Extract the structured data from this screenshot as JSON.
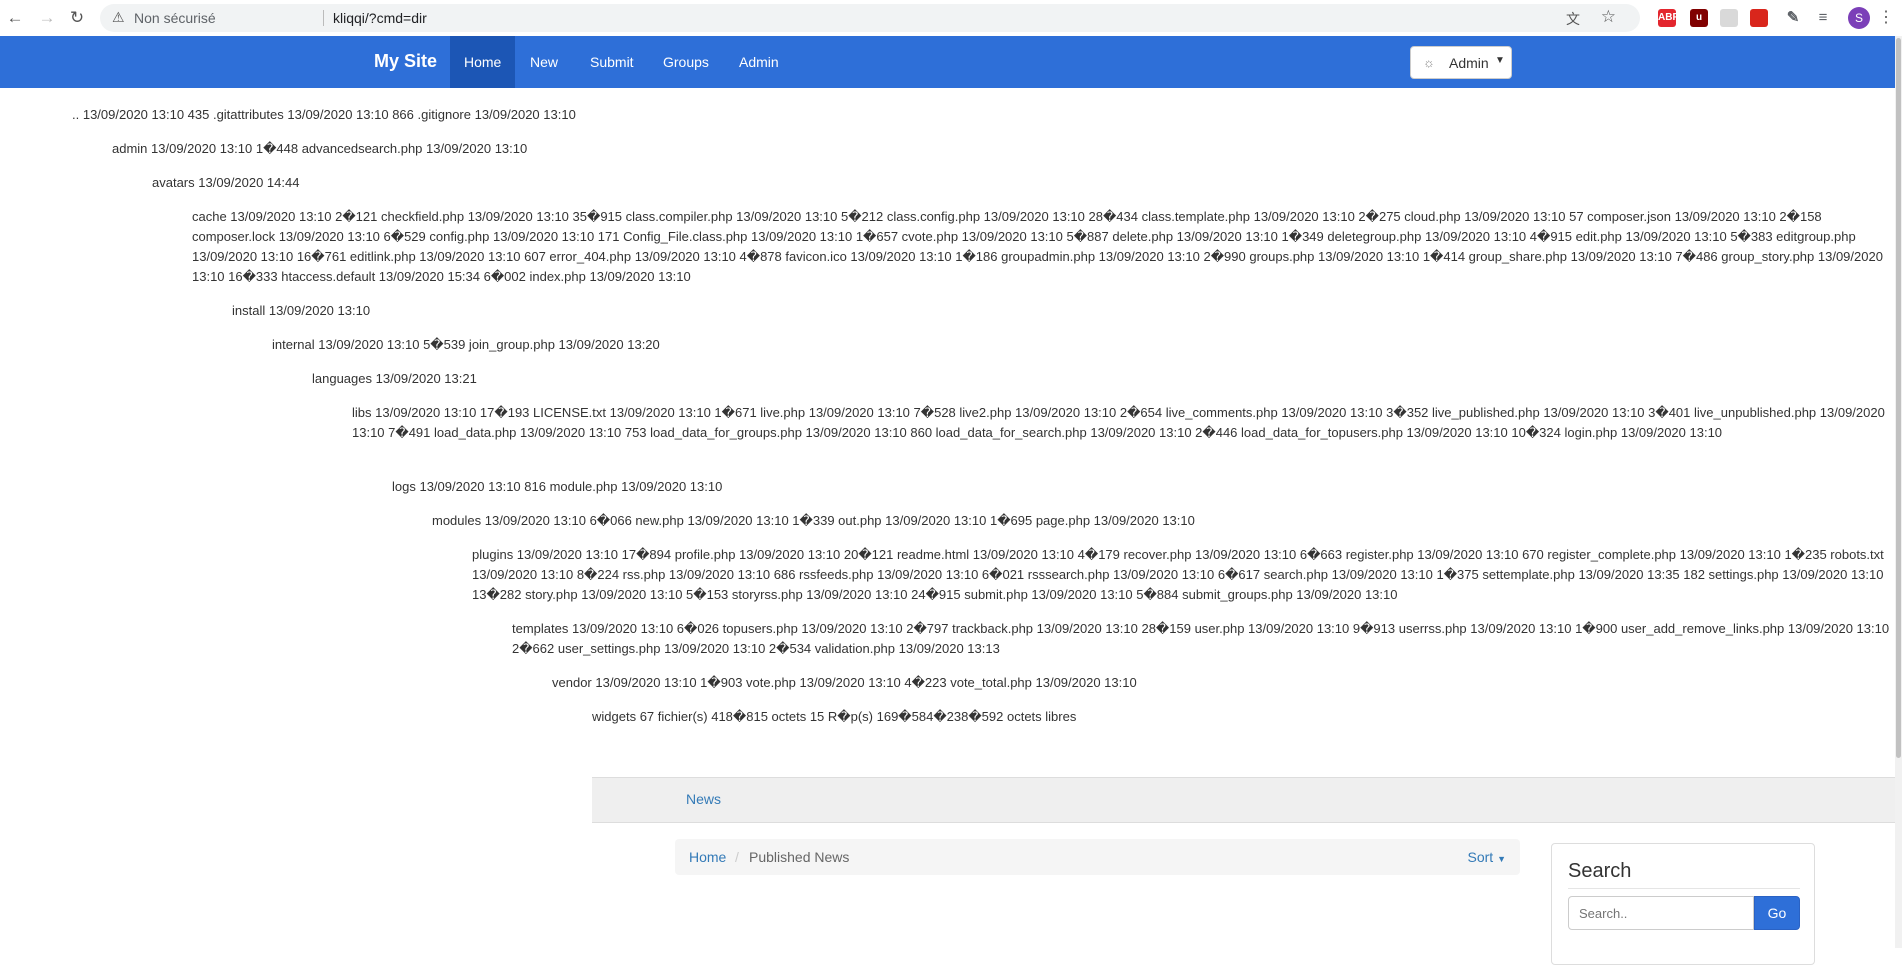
{
  "browser": {
    "security_label": "Non sécurisé",
    "url": "kliqqi/?cmd=dir",
    "profile_initial": "S",
    "extensions": [
      {
        "name": "abp-icon",
        "label": "ABP",
        "color": "#e3262e"
      },
      {
        "name": "ublock-icon",
        "label": "u",
        "color": "#800000"
      },
      {
        "name": "extension-box-icon",
        "label": "",
        "color": "#d9d9d9"
      },
      {
        "name": "screen-icon",
        "label": "",
        "color": "#d9261c"
      },
      {
        "name": "puzzle-icon",
        "label": "",
        "color": "#5f6368"
      },
      {
        "name": "reading-list-icon",
        "label": "",
        "color": "#5f6368"
      }
    ]
  },
  "navbar": {
    "brand": "My Site",
    "links": [
      "Home",
      "New",
      "Submit",
      "Groups",
      "Admin"
    ],
    "active": "Home",
    "admin_button": "Admin"
  },
  "listing": [
    ".. 13/09/2020 13:10 435 .gitattributes 13/09/2020 13:10 866 .gitignore 13/09/2020 13:10",
    "admin 13/09/2020 13:10 1�448 advancedsearch.php 13/09/2020 13:10",
    "avatars 13/09/2020 14:44",
    "cache 13/09/2020 13:10 2�121 checkfield.php 13/09/2020 13:10 35�915 class.compiler.php 13/09/2020 13:10 5�212 class.config.php 13/09/2020 13:10 28�434 class.template.php 13/09/2020 13:10 2�275 cloud.php 13/09/2020 13:10 57 composer.json 13/09/2020 13:10 2�158 composer.lock 13/09/2020 13:10 6�529 config.php 13/09/2020 13:10 171 Config_File.class.php 13/09/2020 13:10 1�657 cvote.php 13/09/2020 13:10 5�887 delete.php 13/09/2020 13:10 1�349 deletegroup.php 13/09/2020 13:10 4�915 edit.php 13/09/2020 13:10 5�383 editgroup.php 13/09/2020 13:10 16�761 editlink.php 13/09/2020 13:10 607 error_404.php 13/09/2020 13:10 4�878 favicon.ico 13/09/2020 13:10 1�186 groupadmin.php 13/09/2020 13:10 2�990 groups.php 13/09/2020 13:10 1�414 group_share.php 13/09/2020 13:10 7�486 group_story.php 13/09/2020 13:10 16�333 htaccess.default 13/09/2020 15:34 6�002 index.php 13/09/2020 13:10",
    "install 13/09/2020 13:10",
    "internal 13/09/2020 13:10 5�539 join_group.php 13/09/2020 13:20",
    "languages 13/09/2020 13:21",
    "libs 13/09/2020 13:10 17�193 LICENSE.txt 13/09/2020 13:10 1�671 live.php 13/09/2020 13:10 7�528 live2.php 13/09/2020 13:10 2�654 live_comments.php 13/09/2020 13:10 3�352 live_published.php 13/09/2020 13:10 3�401 live_unpublished.php 13/09/2020 13:10 7�491 load_data.php 13/09/2020 13:10 753 load_data_for_groups.php 13/09/2020 13:10 860 load_data_for_search.php 13/09/2020 13:10 2�446 load_data_for_topusers.php 13/09/2020 13:10 10�324 login.php 13/09/2020 13:10",
    "logs 13/09/2020 13:10 816 module.php 13/09/2020 13:10",
    "modules 13/09/2020 13:10 6�066 new.php 13/09/2020 13:10 1�339 out.php 13/09/2020 13:10 1�695 page.php 13/09/2020 13:10",
    "plugins 13/09/2020 13:10 17�894 profile.php 13/09/2020 13:10 20�121 readme.html 13/09/2020 13:10 4�179 recover.php 13/09/2020 13:10 6�663 register.php 13/09/2020 13:10 670 register_complete.php 13/09/2020 13:10 1�235 robots.txt 13/09/2020 13:10 8�224 rss.php 13/09/2020 13:10 686 rssfeeds.php 13/09/2020 13:10 6�021 rsssearch.php 13/09/2020 13:10 6�617 search.php 13/09/2020 13:10 1�375 settemplate.php 13/09/2020 13:35 182 settings.php 13/09/2020 13:10 13�282 story.php 13/09/2020 13:10 5�153 storyrss.php 13/09/2020 13:10 24�915 submit.php 13/09/2020 13:10 5�884 submit_groups.php 13/09/2020 13:10",
    "templates 13/09/2020 13:10 6�026 topusers.php 13/09/2020 13:10 2�797 trackback.php 13/09/2020 13:10 28�159 user.php 13/09/2020 13:10 9�913 userrss.php 13/09/2020 13:10 1�900 user_add_remove_links.php 13/09/2020 13:10 2�662 user_settings.php 13/09/2020 13:10 2�534 validation.php 13/09/2020 13:13",
    "vendor 13/09/2020 13:10 1�903 vote.php 13/09/2020 13:10 4�223 vote_total.php 13/09/2020 13:10",
    "widgets 67 fichier(s) 418�815 octets 15 R�p(s) 169�584�238�592 octets libres"
  ],
  "footer_bar": {
    "news_link": "News"
  },
  "breadcrumb": {
    "home": "Home",
    "current": "Published News",
    "sort": "Sort"
  },
  "search": {
    "title": "Search",
    "placeholder": "Search..",
    "button": "Go"
  }
}
